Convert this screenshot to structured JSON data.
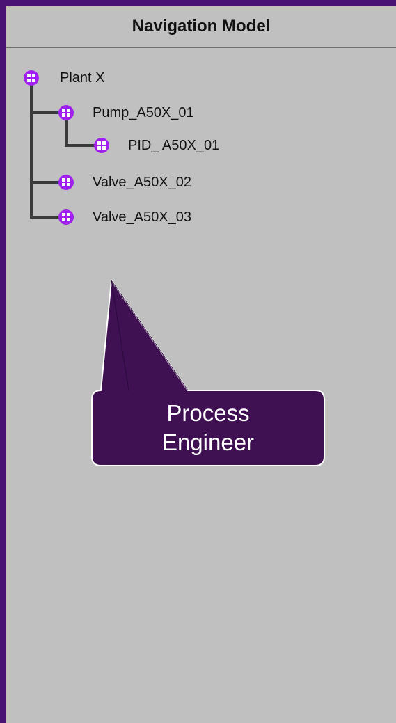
{
  "panel": {
    "title": "Navigation Model"
  },
  "tree": {
    "nodes": [
      {
        "id": "plant",
        "label": "Plant X",
        "icon": "node-icon",
        "depth": 0
      },
      {
        "id": "pump",
        "label": "Pump_A50X_01",
        "icon": "node-icon",
        "depth": 1
      },
      {
        "id": "pid",
        "label": "PID_ A50X_01",
        "icon": "node-icon",
        "depth": 2
      },
      {
        "id": "valve2",
        "label": "Valve_A50X_02",
        "icon": "node-icon",
        "depth": 1
      },
      {
        "id": "valve3",
        "label": "Valve_A50X_03",
        "icon": "node-icon",
        "depth": 1
      }
    ]
  },
  "callout": {
    "line1": "Process",
    "line2": "Engineer"
  },
  "colors": {
    "background": "#4a1273",
    "panel": "#c0c0c0",
    "icon": "#a020f0",
    "connector": "#3a3a3a",
    "callout_fill": "#3f1052",
    "callout_text": "#ffffff"
  }
}
